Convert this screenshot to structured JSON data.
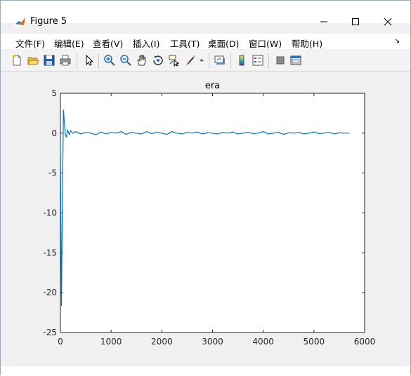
{
  "window": {
    "title": "Figure 5",
    "controls": {
      "minimize": "minimize-icon",
      "maximize": "maximize-icon",
      "close": "close-icon"
    }
  },
  "menu": [
    "文件(F)",
    "编辑(E)",
    "查看(V)",
    "插入(I)",
    "工具(T)",
    "桌面(D)",
    "窗口(W)",
    "帮助(H)"
  ],
  "toolbar_icons": [
    "new-figure-icon",
    "open-file-icon",
    "save-icon",
    "print-icon",
    "select-arrow-icon",
    "zoom-in-icon",
    "zoom-out-icon",
    "pan-hand-icon",
    "rotate-3d-icon",
    "data-cursor-icon",
    "brush-icon",
    "brush-dropdown-icon",
    "link-plot-icon",
    "colorbar-icon",
    "legend-icon",
    "hide-plot-tools-icon",
    "show-plot-tools-icon"
  ],
  "colors": {
    "line": "#0072bd",
    "axes_bg": "#ffffff",
    "figure_bg": "#f0f0f0"
  },
  "chart_data": {
    "type": "line",
    "title": "era",
    "xlabel": "",
    "ylabel": "",
    "xlim": [
      0,
      6000
    ],
    "ylim": [
      -25,
      5
    ],
    "xticks": [
      "0",
      "1000",
      "2000",
      "3000",
      "4000",
      "5000",
      "6000"
    ],
    "yticks": [
      "5",
      "0",
      "-5",
      "-10",
      "-15",
      "-20",
      "-25"
    ],
    "grid": false,
    "series": [
      {
        "name": "",
        "x": [
          0,
          20,
          40,
          60,
          80,
          100,
          120,
          140,
          160,
          180,
          200,
          250,
          300,
          400,
          500,
          600,
          700,
          800,
          900,
          1000,
          1100,
          1200,
          1300,
          1400,
          1500,
          1600,
          1700,
          1800,
          1900,
          2000,
          2100,
          2200,
          2300,
          2400,
          2500,
          2600,
          2700,
          2800,
          2900,
          3000,
          3100,
          3200,
          3300,
          3400,
          3500,
          3600,
          3700,
          3800,
          3900,
          4000,
          4100,
          4200,
          4300,
          4400,
          4500,
          4600,
          4700,
          4800,
          4900,
          5000,
          5100,
          5200,
          5300,
          5400,
          5500,
          5600,
          5700
        ],
        "y": [
          -1.0,
          -21.6,
          -8.0,
          2.9,
          1.2,
          -0.3,
          -0.5,
          0.4,
          0.1,
          -0.2,
          0.3,
          0.0,
          0.2,
          -0.1,
          0.1,
          0.0,
          -0.2,
          0.15,
          -0.1,
          0.1,
          0.0,
          0.2,
          -0.15,
          0.1,
          0.0,
          -0.1,
          0.2,
          -0.05,
          0.1,
          0.0,
          -0.15,
          0.2,
          0.0,
          -0.1,
          0.1,
          0.0,
          0.15,
          -0.1,
          0.05,
          0.0,
          -0.1,
          0.1,
          0.0,
          0.15,
          -0.1,
          0.0,
          0.1,
          -0.05,
          0.0,
          0.2,
          -0.1,
          0.0,
          0.1,
          -0.15,
          0.05,
          0.0,
          0.1,
          -0.1,
          0.0,
          0.15,
          -0.05,
          0.0,
          0.1,
          -0.1,
          0.05,
          0.0,
          0.0
        ]
      }
    ]
  }
}
